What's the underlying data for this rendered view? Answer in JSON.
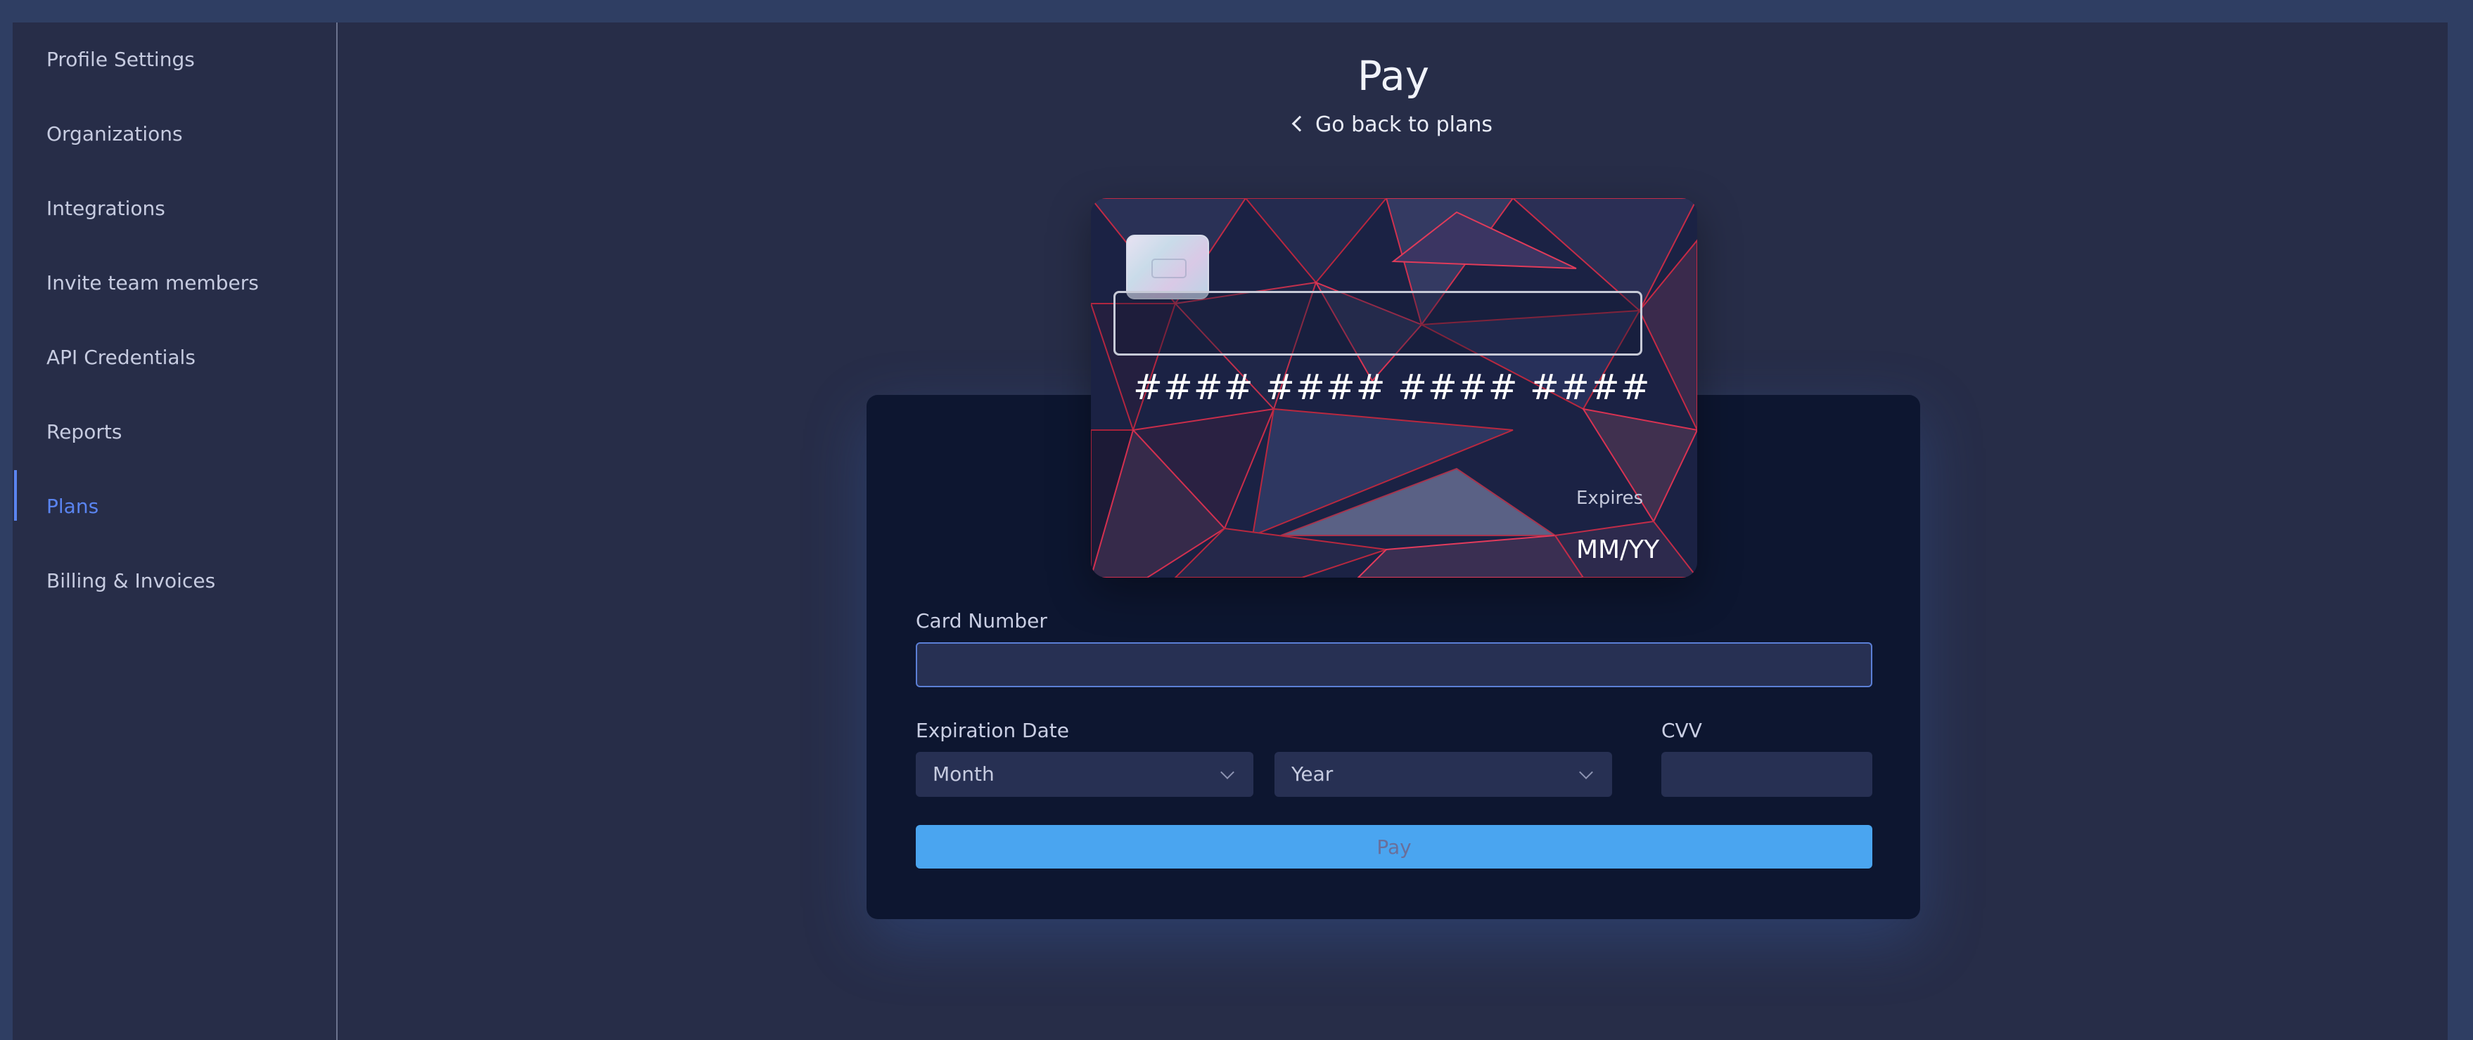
{
  "sidebar": {
    "items": [
      {
        "label": "Profile Settings",
        "active": false
      },
      {
        "label": "Organizations",
        "active": false
      },
      {
        "label": "Integrations",
        "active": false
      },
      {
        "label": "Invite team members",
        "active": false
      },
      {
        "label": "API Credentials",
        "active": false
      },
      {
        "label": "Reports",
        "active": false
      },
      {
        "label": "Plans",
        "active": true
      },
      {
        "label": "Billing & Invoices",
        "active": false
      }
    ]
  },
  "main": {
    "title": "Pay",
    "back_link": "Go back to plans"
  },
  "card_preview": {
    "groups": [
      "####",
      "####",
      "####",
      "####"
    ],
    "expires_label": "Expires",
    "expires_value": "MM/YY"
  },
  "form": {
    "card_number_label": "Card Number",
    "card_number_value": "",
    "expiration_label": "Expiration Date",
    "month_selected": "Month",
    "year_selected": "Year",
    "cvv_label": "CVV",
    "cvv_value": "",
    "pay_label": "Pay"
  },
  "colors": {
    "accent": "#5a84f0",
    "pay_button": "#4aa5f0",
    "panel": "#0d1630",
    "background": "#272d48"
  }
}
